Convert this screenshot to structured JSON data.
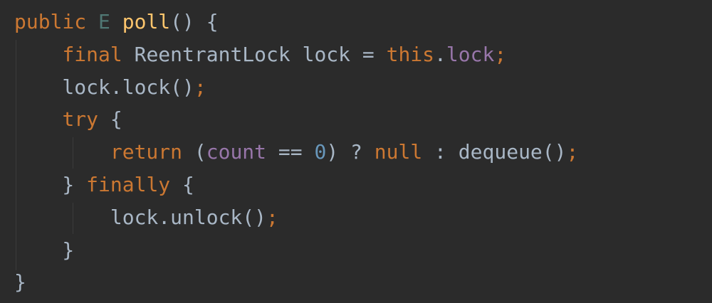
{
  "colors": {
    "background": "#2b2b2b",
    "keyword": "#cc7832",
    "method_declaration": "#ffc66d",
    "field": "#9876aa",
    "number": "#6897bb",
    "type_parameter": "#507874",
    "default_text": "#a9b7c6"
  },
  "code": {
    "lines": [
      [
        {
          "t": "public",
          "c": "kw"
        },
        {
          "t": " ",
          "c": "plain"
        },
        {
          "t": "E",
          "c": "type-param"
        },
        {
          "t": " ",
          "c": "plain"
        },
        {
          "t": "poll",
          "c": "fn"
        },
        {
          "t": "() {",
          "c": "plain"
        }
      ],
      [
        {
          "t": "    ",
          "c": "plain"
        },
        {
          "t": "final",
          "c": "kw"
        },
        {
          "t": " ReentrantLock lock = ",
          "c": "plain"
        },
        {
          "t": "this",
          "c": "kw"
        },
        {
          "t": ".",
          "c": "plain"
        },
        {
          "t": "lock",
          "c": "field"
        },
        {
          "t": ";",
          "c": "kw"
        }
      ],
      [
        {
          "t": "    lock.lock()",
          "c": "plain"
        },
        {
          "t": ";",
          "c": "kw"
        }
      ],
      [
        {
          "t": "    ",
          "c": "plain"
        },
        {
          "t": "try",
          "c": "kw"
        },
        {
          "t": " {",
          "c": "plain"
        }
      ],
      [
        {
          "t": "        ",
          "c": "plain"
        },
        {
          "t": "return",
          "c": "kw"
        },
        {
          "t": " (",
          "c": "plain"
        },
        {
          "t": "count",
          "c": "field"
        },
        {
          "t": " == ",
          "c": "plain"
        },
        {
          "t": "0",
          "c": "num"
        },
        {
          "t": ") ? ",
          "c": "plain"
        },
        {
          "t": "null",
          "c": "kw"
        },
        {
          "t": " : dequeue()",
          "c": "plain"
        },
        {
          "t": ";",
          "c": "kw"
        }
      ],
      [
        {
          "t": "    } ",
          "c": "plain"
        },
        {
          "t": "finally",
          "c": "kw"
        },
        {
          "t": " {",
          "c": "plain"
        }
      ],
      [
        {
          "t": "        lock.unlock()",
          "c": "plain"
        },
        {
          "t": ";",
          "c": "kw"
        }
      ],
      [
        {
          "t": "    }",
          "c": "plain"
        }
      ],
      [
        {
          "t": "}",
          "c": "plain"
        }
      ]
    ]
  }
}
